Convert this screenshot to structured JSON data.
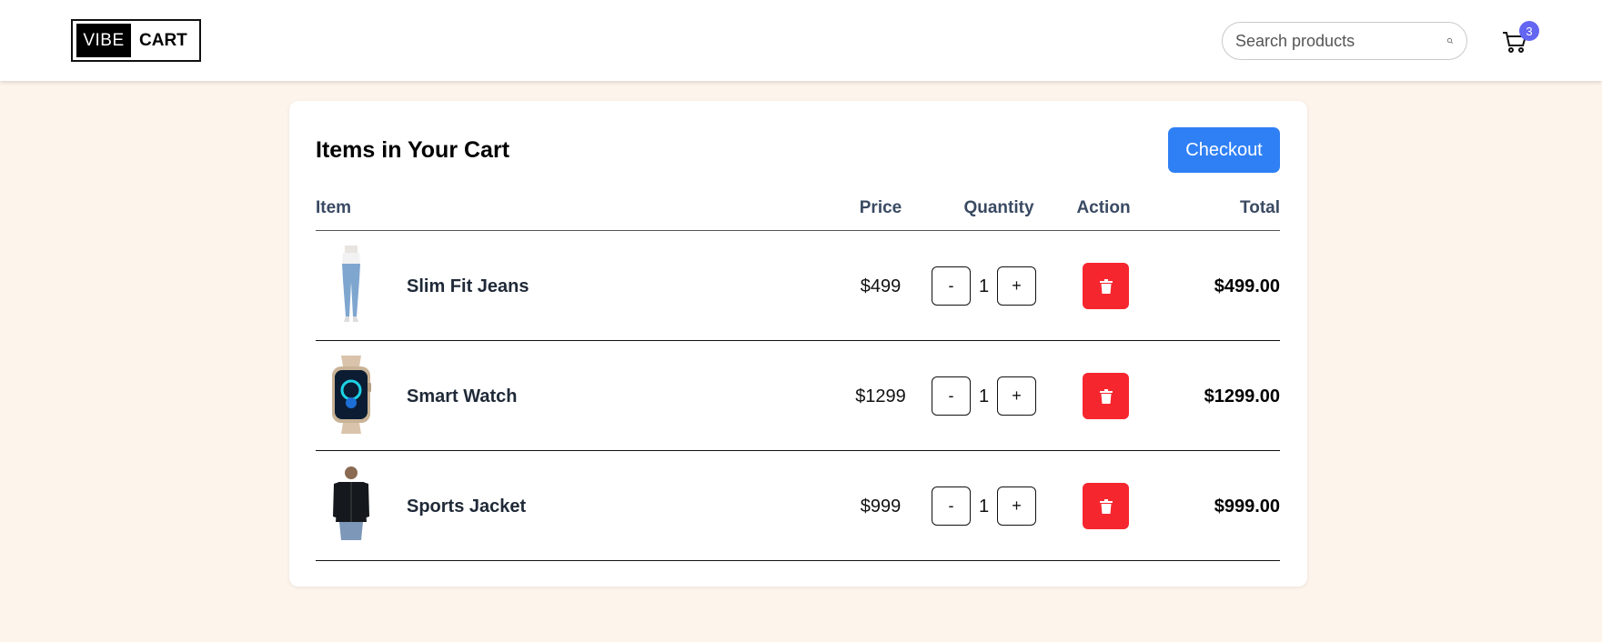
{
  "header": {
    "logo_left": "VIBE",
    "logo_right": "CART",
    "search_placeholder": "Search products",
    "cart_count": "3",
    "badge_color": "#6366f1"
  },
  "cart": {
    "title": "Items in Your Cart",
    "checkout_label": "Checkout",
    "columns": {
      "item": "Item",
      "price": "Price",
      "quantity": "Quantity",
      "action": "Action",
      "total": "Total"
    },
    "rows": [
      {
        "name": "Slim Fit Jeans",
        "price": "$499",
        "minus": "-",
        "qty": "1",
        "plus": "+",
        "total": "$499.00"
      },
      {
        "name": "Smart Watch",
        "price": "$1299",
        "minus": "-",
        "qty": "1",
        "plus": "+",
        "total": "$1299.00"
      },
      {
        "name": "Sports Jacket",
        "price": "$999",
        "minus": "-",
        "qty": "1",
        "plus": "+",
        "total": "$999.00"
      }
    ]
  },
  "colors": {
    "background": "#fdf4ec",
    "checkout": "#2f80f5",
    "delete": "#f6262f"
  }
}
